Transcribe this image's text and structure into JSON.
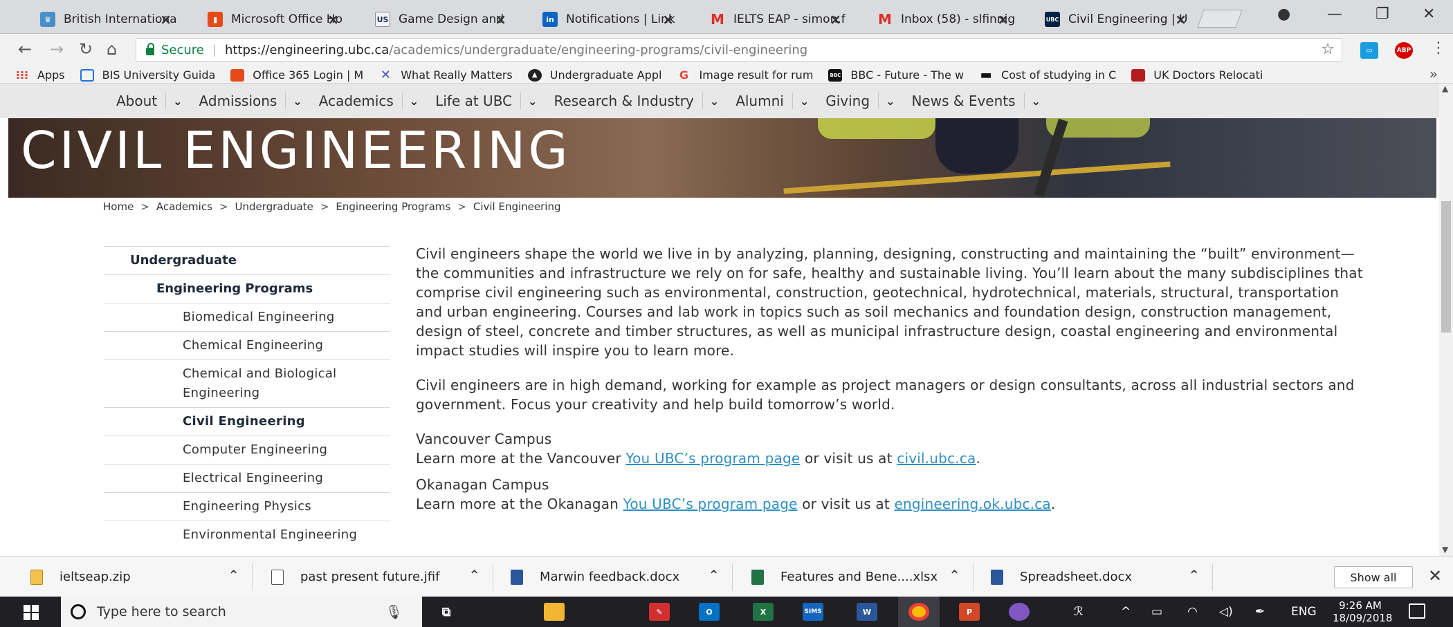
{
  "tabs": [
    {
      "label": "British Internationa",
      "icon": "crown-favicon-icon",
      "color": "#4a90c8",
      "active": false
    },
    {
      "label": "Microsoft Office Ho",
      "icon": "office-favicon-icon",
      "color": "#e64a19",
      "active": false
    },
    {
      "label": "Game Design and",
      "icon": "us-favicon-icon",
      "icon_text": "US",
      "color": "#f4f4f4",
      "active": false
    },
    {
      "label": "Notifications | Link",
      "icon": "linkedin-favicon-icon",
      "icon_text": "in",
      "color": "#0a66c2",
      "active": false
    },
    {
      "label": "IELTS EAP - simon.f",
      "icon": "gmail-favicon-icon",
      "icon_text": "M",
      "color": "#d93025",
      "active": false
    },
    {
      "label": "Inbox (58) - slfinnig",
      "icon": "gmail-favicon-icon",
      "icon_text": "M",
      "color": "#d93025",
      "active": false
    },
    {
      "label": "Civil Engineering | U",
      "icon": "ubc-favicon-icon",
      "icon_text": "UBC",
      "color": "#002145",
      "active": true
    }
  ],
  "address": {
    "secure_label": "Secure",
    "url_main": "https://engineering.ubc.ca",
    "url_rest": "/academics/undergraduate/engineering-programs/civil-engineering"
  },
  "bookmarks": [
    {
      "label": "Apps",
      "icon": "apps-grid-icon",
      "color": "#e94235"
    },
    {
      "label": "BIS University Guida",
      "icon": "calendar-icon",
      "color": "#1a73e8"
    },
    {
      "label": "Office 365 Login | M",
      "icon": "office-icon",
      "color": "#e64a19"
    },
    {
      "label": "What Really Matters",
      "icon": "x-mark-icon",
      "color": "#3f51b5"
    },
    {
      "label": "Undergraduate Appl",
      "icon": "badge-icon",
      "color": "#222222"
    },
    {
      "label": "Image result for rum",
      "icon": "google-icon",
      "icon_text": "G",
      "color": "#ea4335"
    },
    {
      "label": "BBC - Future - The w",
      "icon": "bbc-icon",
      "icon_text": "BBC",
      "color": "#111111"
    },
    {
      "label": "Cost of studying in C",
      "icon": "dash-icon",
      "color": "#111111"
    },
    {
      "label": "UK Doctors Relocati",
      "icon": "chart-icon",
      "color": "#b71c1c"
    }
  ],
  "site_nav": [
    "About",
    "Admissions",
    "Academics",
    "Life at UBC",
    "Research & Industry",
    "Alumni",
    "Giving",
    "News & Events"
  ],
  "hero_title": "CIVIL ENGINEERING",
  "breadcrumb": [
    "Home",
    "Academics",
    "Undergraduate",
    "Engineering Programs",
    "Civil Engineering"
  ],
  "breadcrumb_separator": ">",
  "side_nav": [
    {
      "label": "Undergraduate",
      "level": 1
    },
    {
      "label": "Engineering Programs",
      "level": 2
    },
    {
      "label": "Biomedical Engineering",
      "level": 3
    },
    {
      "label": "Chemical Engineering",
      "level": 3
    },
    {
      "label": "Chemical and Biological Engineering",
      "level": 3
    },
    {
      "label": "Civil Engineering",
      "level": 3,
      "current": true
    },
    {
      "label": "Computer Engineering",
      "level": 3
    },
    {
      "label": "Electrical Engineering",
      "level": 3
    },
    {
      "label": "Engineering Physics",
      "level": 3
    },
    {
      "label": "Environmental Engineering",
      "level": 3
    }
  ],
  "content": {
    "para1": "Civil engineers shape the world we live in by analyzing, planning, designing, constructing and maintaining the “built” environment— the communities and infrastructure we rely on for safe, healthy and sustainable living. You’ll learn about the many subdisciplines that comprise civil engineering such as environmental, construction, geotechnical, hydrotechnical, materials, structural, transportation and urban engineering. Courses and lab work in topics such as soil mechanics and foundation design, construction management, design of steel, concrete and timber structures, as well as municipal infrastructure design, coastal engineering and environmental impact studies will inspire you to learn more.",
    "para2": "Civil engineers are in high demand, working for example as project managers or design consultants, across all industrial sectors and government. Focus your creativity and help build tomorrow’s world.",
    "vancouver": {
      "heading": "Vancouver Campus",
      "prefix": "Learn more at the Vancouver ",
      "link1": "You UBC’s program page",
      "middle": " or visit us at ",
      "link2": "civil.ubc.ca",
      "suffix": "."
    },
    "okanagan": {
      "heading": "Okanagan Campus",
      "prefix": "Learn more at the Okanagan ",
      "link1": "You UBC’s program page",
      "middle": " or visit us at ",
      "link2": "engineering.ok.ubc.ca",
      "suffix": "."
    }
  },
  "downloads": [
    {
      "name": "ieltseap.zip",
      "icon": "zip-file-icon",
      "color": "#f2c14e"
    },
    {
      "name": "past present future.jfif",
      "icon": "blank-file-icon",
      "color": "#ffffff"
    },
    {
      "name": "Marwin feedback.docx",
      "icon": "word-file-icon",
      "color": "#2b579a"
    },
    {
      "name": "Features and Bene....xlsx",
      "icon": "excel-file-icon",
      "color": "#217346"
    },
    {
      "name": "Spreadsheet.docx",
      "icon": "word-file-icon",
      "color": "#2b579a"
    }
  ],
  "show_all_label": "Show all",
  "taskbar": {
    "search_placeholder": "Type here to search",
    "apps": [
      {
        "icon": "task-view-icon",
        "color": "#1f1f24"
      },
      {
        "icon": "file-explorer-icon",
        "color": "#f2b632"
      },
      {
        "icon": "acrobat-icon",
        "color": "#d32f2f"
      },
      {
        "icon": "outlook-icon",
        "color": "#0072c6",
        "text": "O"
      },
      {
        "icon": "excel-icon",
        "color": "#217346",
        "text": "X"
      },
      {
        "icon": "sims-icon",
        "color": "#1565c0",
        "text": "SIMS"
      },
      {
        "icon": "word-icon",
        "color": "#2b579a",
        "text": "W"
      },
      {
        "icon": "chrome-icon",
        "color": "#fbbc05"
      },
      {
        "icon": "powerpoint-icon",
        "color": "#d24726",
        "text": "P"
      },
      {
        "icon": "paint-icon",
        "color": "#7e57c2"
      }
    ],
    "language": "ENG",
    "time": "9:26 AM",
    "date": "18/09/2018"
  }
}
